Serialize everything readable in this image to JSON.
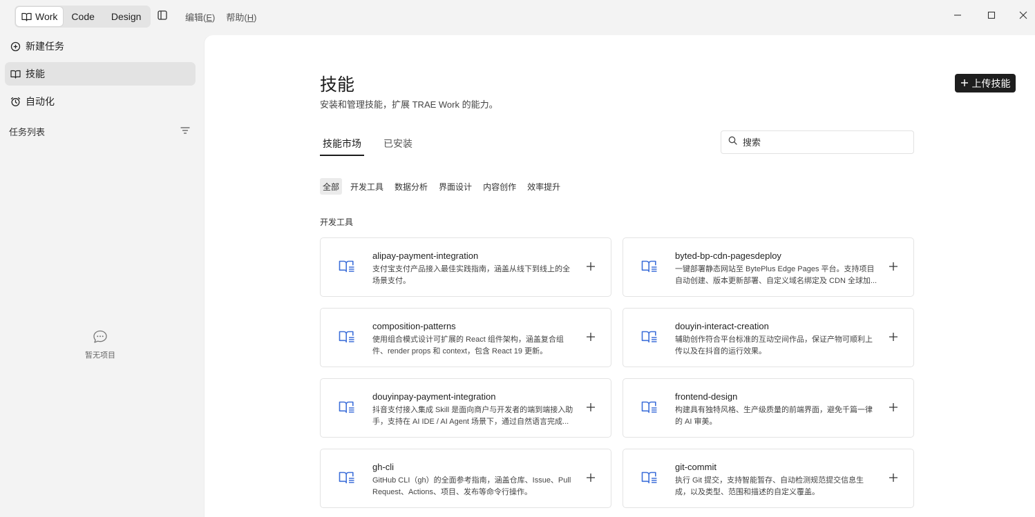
{
  "titlebar": {
    "modes": [
      {
        "label": "Work",
        "active": true,
        "icon": "book-open-icon"
      },
      {
        "label": "Code",
        "active": false
      },
      {
        "label": "Design",
        "active": false
      }
    ],
    "menu": [
      {
        "label": "编辑",
        "key": "E"
      },
      {
        "label": "帮助",
        "key": "H"
      }
    ]
  },
  "sidebar": {
    "nav": [
      {
        "label": "新建任务",
        "icon": "plus-circle-icon",
        "active": false
      },
      {
        "label": "技能",
        "icon": "book-icon",
        "active": true
      },
      {
        "label": "自动化",
        "icon": "alarm-clock-icon",
        "active": false
      }
    ],
    "task_list_title": "任务列表",
    "empty_text": "暂无项目"
  },
  "main": {
    "title": "技能",
    "subtitle": "安装和管理技能，扩展 TRAE Work 的能力。",
    "upload_label": "上传技能",
    "tabs": [
      {
        "label": "技能市场",
        "active": true
      },
      {
        "label": "已安装",
        "active": false
      }
    ],
    "search_placeholder": "搜索",
    "filters": [
      {
        "label": "全部",
        "active": true
      },
      {
        "label": "开发工具",
        "active": false
      },
      {
        "label": "数据分析",
        "active": false
      },
      {
        "label": "界面设计",
        "active": false
      },
      {
        "label": "内容创作",
        "active": false
      },
      {
        "label": "效率提升",
        "active": false
      }
    ],
    "section_title": "开发工具",
    "skills": [
      {
        "title": "alipay-payment-integration",
        "desc": "支付宝支付产品接入最佳实践指南，涵盖从线下到线上的全场景支付。"
      },
      {
        "title": "byted-bp-cdn-pagesdeploy",
        "desc": "一键部署静态网站至 BytePlus Edge Pages 平台。支持项目自动创建、版本更新部署、自定义域名绑定及 CDN 全球加..."
      },
      {
        "title": "composition-patterns",
        "desc": "使用组合模式设计可扩展的 React 组件架构，涵盖复合组件、render props 和 context，包含 React 19 更新。"
      },
      {
        "title": "douyin-interact-creation",
        "desc": "辅助创作符合平台标准的互动空间作品，保证产物可顺利上传以及在抖音的运行效果。"
      },
      {
        "title": "douyinpay-payment-integration",
        "desc": "抖音支付接入集成 Skill 是面向商户与开发者的端到端接入助手，支持在 AI IDE / AI Agent 场景下，通过自然语言完成..."
      },
      {
        "title": "frontend-design",
        "desc": "构建具有独特风格、生产级质量的前端界面，避免千篇一律的 AI 审美。"
      },
      {
        "title": "gh-cli",
        "desc": "GitHub CLI（gh）的全面参考指南，涵盖仓库、Issue、Pull Request、Actions、项目、发布等命令行操作。"
      },
      {
        "title": "git-commit",
        "desc": "执行 Git 提交，支持智能暂存、自动检测规范提交信息生成，以及类型、范围和描述的自定义覆盖。"
      }
    ]
  },
  "colors": {
    "accent_blue": "#3d6fd9",
    "dark_button": "#1e1e1e"
  }
}
